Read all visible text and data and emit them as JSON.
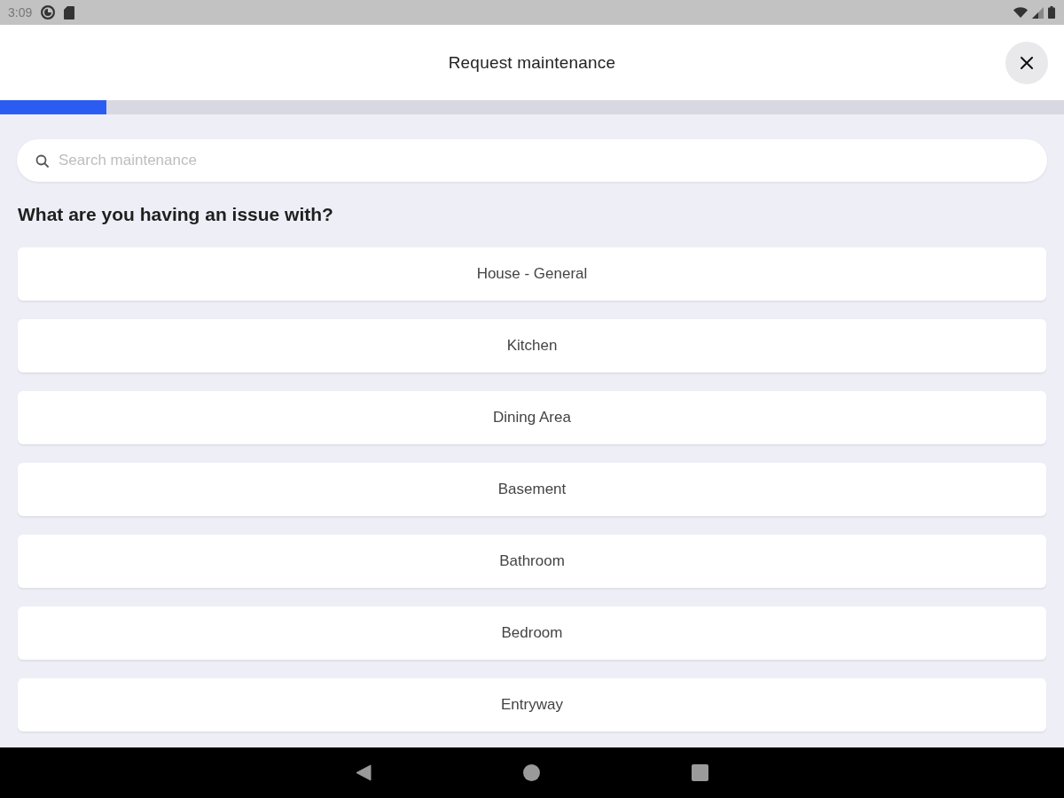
{
  "status_bar": {
    "time": "3:09"
  },
  "header": {
    "title": "Request maintenance"
  },
  "progress": {
    "level": 0.1
  },
  "search": {
    "placeholder": "Search maintenance"
  },
  "question": "What are you having an issue with?",
  "categories": [
    {
      "label": "House - General"
    },
    {
      "label": "Kitchen"
    },
    {
      "label": "Dining Area"
    },
    {
      "label": "Basement"
    },
    {
      "label": "Bathroom"
    },
    {
      "label": "Bedroom"
    },
    {
      "label": "Entryway"
    }
  ]
}
